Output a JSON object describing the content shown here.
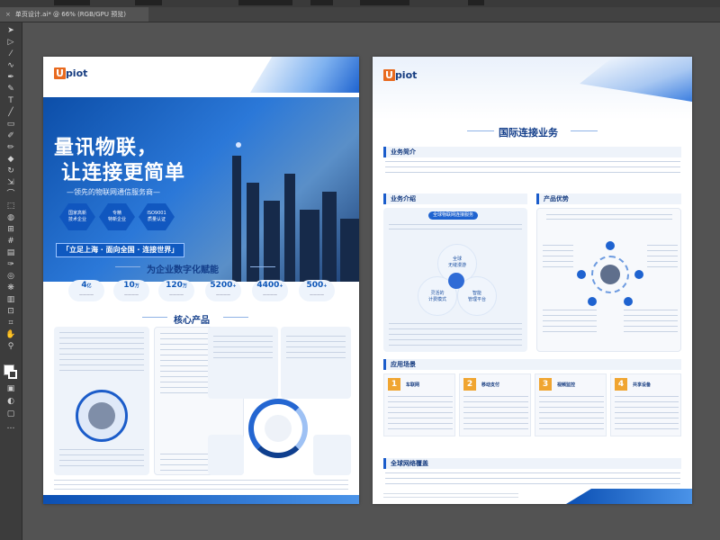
{
  "window": {
    "tab_title": "单页设计.ai* @ 66% (RGB/GPU 预览)",
    "close_glyph": "×"
  },
  "tools": [
    "select-icon",
    "direct-select-icon",
    "magic-wand-icon",
    "lasso-icon",
    "pen-icon",
    "curvature-icon",
    "type-icon",
    "line-icon",
    "rectangle-icon",
    "paintbrush-icon",
    "pencil-icon",
    "eraser-icon",
    "rotate-icon",
    "scale-icon",
    "width-icon",
    "free-transform-icon",
    "shape-builder-icon",
    "perspective-icon",
    "mesh-icon",
    "gradient-icon",
    "eyedropper-icon",
    "blend-icon",
    "symbol-icon",
    "graph-icon",
    "artboard-icon",
    "slice-icon",
    "hand-icon",
    "zoom-icon"
  ],
  "left_page": {
    "logo_letter": "U",
    "logo_rest": "piot",
    "hero_title_1": "量讯物联，",
    "hero_title_2": "让连接更简单",
    "hero_subtitle": "—领先的物联网通信服务商—",
    "hex_badges": [
      "国家高新\n技术企业",
      "专精\n特新企业",
      "ISO9001\n质量认证"
    ],
    "slogan": "「立足上海 · 面向全国 · 连接世界」",
    "section_digital": "为企业数字化赋能",
    "stats": [
      {
        "value": "4",
        "unit": "亿"
      },
      {
        "value": "10",
        "unit": "万"
      },
      {
        "value": "120",
        "unit": "万"
      },
      {
        "value": "5200",
        "unit": "+"
      },
      {
        "value": "4400",
        "unit": "+"
      },
      {
        "value": "500",
        "unit": "+"
      }
    ],
    "section_product": "核心产品"
  },
  "right_page": {
    "logo_letter": "U",
    "logo_rest": "piot",
    "title": "国际连接业务",
    "headers": {
      "intro": "业务简介",
      "business": "业务介绍",
      "advantage": "产品优势",
      "apps": "应用场景",
      "coverage": "全球网络覆盖"
    },
    "business_pill": "全球物联网连接服务",
    "bubbles": [
      "全球\n无缝漫游",
      "灵活的\n计费模式",
      "智能\n管理平台"
    ],
    "apps": [
      {
        "num": "1",
        "label": "车联网"
      },
      {
        "num": "2",
        "label": "移动支付"
      },
      {
        "num": "3",
        "label": "视频监控"
      },
      {
        "num": "4",
        "label": "共享设备"
      }
    ]
  },
  "colors": {
    "brand_blue": "#0f57b8",
    "accent_orange": "#e86a1f",
    "app_gold": "#f0a531",
    "canvas_bg": "#535353"
  }
}
